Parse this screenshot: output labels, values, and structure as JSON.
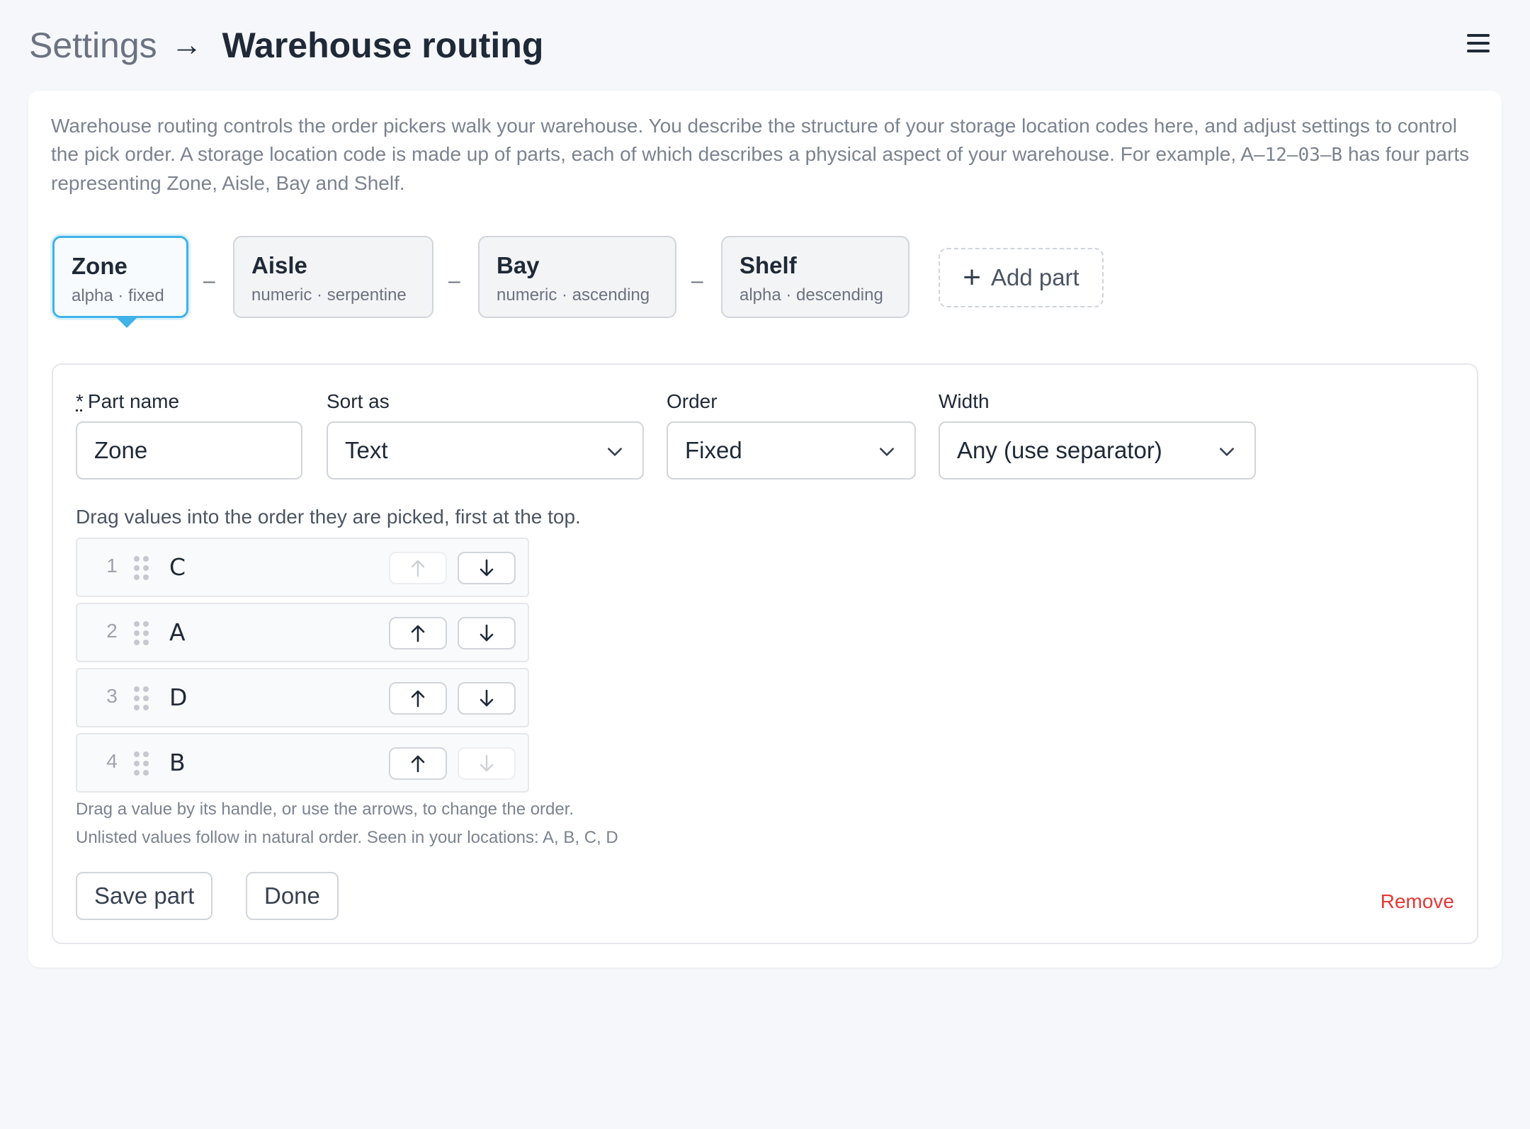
{
  "header": {
    "breadcrumb": "Settings",
    "breadcrumb_arrow": "→",
    "title": "Warehouse routing",
    "menu_icon": "hamburger-menu-icon"
  },
  "intro": {
    "text_before_code": "Warehouse routing controls the order pickers walk your warehouse. You describe the structure of your storage location codes here, and adjust settings to control the pick order. A storage location code is made up of parts, each of which describes a physical aspect of your warehouse. For example, A–",
    "code": "12–03–B",
    "text_after_code": " has four parts representing Zone, Aisle, Bay and Shelf."
  },
  "parts": [
    {
      "name": "Zone",
      "desc": "alpha · fixed",
      "active": true
    },
    {
      "name": "Aisle",
      "desc": "numeric · serpentine",
      "active": false
    },
    {
      "name": "Bay",
      "desc": "numeric · ascending",
      "active": false
    },
    {
      "name": "Shelf",
      "desc": "alpha · descending",
      "active": false
    }
  ],
  "separator": "–",
  "add_part_label": "Add part",
  "editor": {
    "part_name_required_mark": "*",
    "part_name_label": "Part name",
    "part_name_value": "Zone",
    "sort_as_label": "Sort as",
    "sort_as_value": "Text",
    "order_label": "Order",
    "order_value": "Fixed",
    "width_label": "Width",
    "width_value": "Any (use separator)",
    "drag_hint": "Drag values into the order they are picked, first at the top.",
    "values": [
      {
        "num": "1",
        "value": "C",
        "up_enabled": false,
        "down_enabled": true
      },
      {
        "num": "2",
        "value": "A",
        "up_enabled": true,
        "down_enabled": true
      },
      {
        "num": "3",
        "value": "D",
        "up_enabled": true,
        "down_enabled": true
      },
      {
        "num": "4",
        "value": "B",
        "up_enabled": true,
        "down_enabled": false
      }
    ],
    "note_1": "Drag a value by its handle, or use the arrows, to change the order.",
    "note_2": "Unlisted values follow in natural order. Seen in your locations: A, B, C, D",
    "save_label": "Save part",
    "done_label": "Done",
    "remove_label": "Remove"
  },
  "colors": {
    "accent": "#3fb3e8",
    "danger": "#e53935"
  }
}
